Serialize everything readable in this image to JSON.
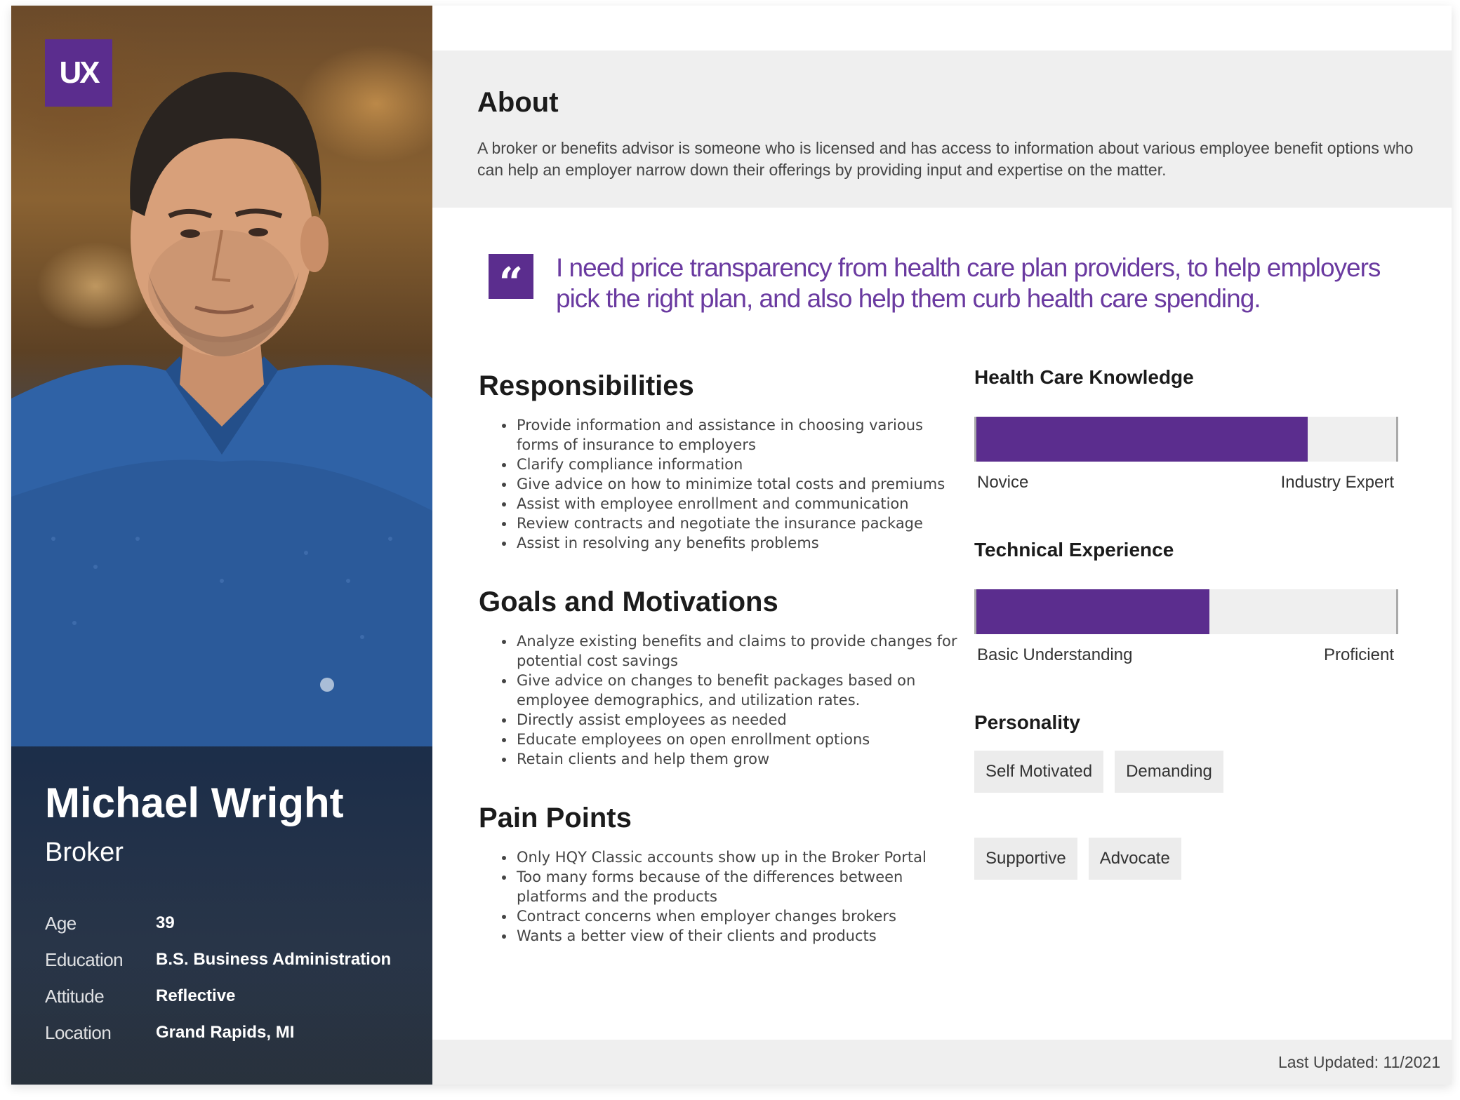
{
  "brand": {
    "logo_text": "UX",
    "accent": "#5b2d8e"
  },
  "profile": {
    "name": "Michael Wright",
    "role": "Broker",
    "facts": [
      {
        "label": "Age",
        "value": "39"
      },
      {
        "label": "Education",
        "value": "B.S. Business Administration"
      },
      {
        "label": "Attitude",
        "value": "Reflective"
      },
      {
        "label": "Location",
        "value": "Grand Rapids, MI"
      }
    ]
  },
  "about": {
    "title": "About",
    "text": "A broker or benefits advisor is someone who is licensed and has access to information about various employee benefit options who can help an employer narrow down their offerings by providing input and expertise on the matter."
  },
  "quote": {
    "mark": "“",
    "text": "I need price transparency from health care plan providers, to help employers pick the right plan, and also help them curb health care spending."
  },
  "responsibilities": {
    "title": "Responsibilities",
    "items": [
      "Provide information and assistance in choosing various forms of insurance to employers",
      "Clarify compliance information",
      "Give advice on how to minimize total costs and premiums",
      "Assist with employee enrollment and communication",
      "Review contracts and negotiate the insurance package",
      "Assist in resolving any benefits problems"
    ]
  },
  "goals": {
    "title": "Goals and Motivations",
    "items": [
      "Analyze existing benefits and claims to provide changes for potential cost savings",
      "Give advice on changes to benefit packages based on employee demographics, and utilization rates.",
      "Directly assist employees as needed",
      "Educate employees on open enrollment options",
      "Retain clients and help them grow"
    ]
  },
  "pain_points": {
    "title": "Pain Points",
    "items": [
      "Only HQY Classic accounts show up in the Broker Portal",
      "Too many forms because of the differences between platforms and the products",
      "Contract concerns when employer changes brokers",
      "Wants a better view of their clients and products"
    ]
  },
  "health_care_knowledge": {
    "title": "Health Care Knowledge",
    "level": 0.79,
    "min_label": "Novice",
    "max_label": "Industry Expert"
  },
  "technical_experience": {
    "title": "Technical Experience",
    "level": 0.555,
    "min_label": "Basic Understanding",
    "max_label": "Proficient"
  },
  "personality": {
    "title": "Personality",
    "tags": [
      "Self Motivated",
      "Demanding",
      "Supportive",
      "Advocate"
    ]
  },
  "footer": {
    "last_updated": "Last Updated: 11/2021"
  }
}
